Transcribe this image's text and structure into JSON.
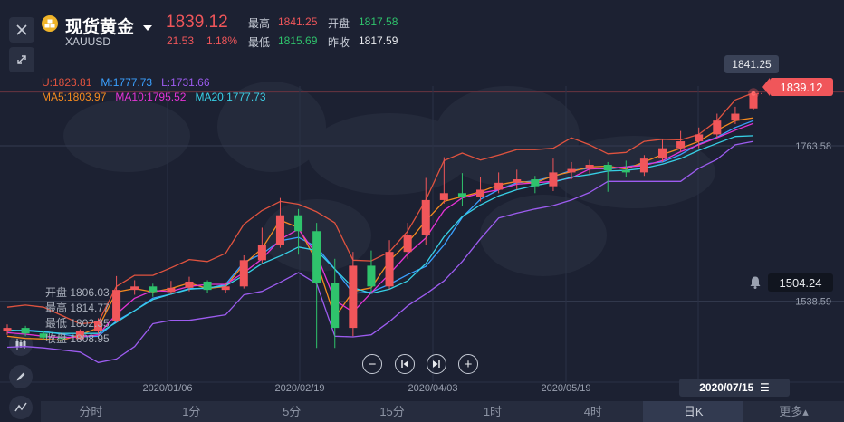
{
  "header": {
    "name": "现货黄金",
    "symbol": "XAUUSD",
    "price": "1839.12",
    "change": "21.53",
    "change_pct": "1.18%",
    "stats": [
      {
        "label": "最高",
        "value": "1841.25",
        "color": "#f0565a"
      },
      {
        "label": "开盘",
        "value": "1817.58",
        "color": "#2fc36c"
      },
      {
        "label": "最低",
        "value": "1815.69",
        "color": "#2fc36c"
      },
      {
        "label": "昨收",
        "value": "1817.59",
        "color": "#e8eaee"
      }
    ]
  },
  "indicators": {
    "boll_u": "U:1823.81",
    "boll_m": "M:1777.73",
    "boll_l": "L:1731.66",
    "ma5": "MA5:1803.97",
    "ma10": "MA10:1795.52",
    "ma20": "MA20:1777.73"
  },
  "crosshair": {
    "open": "开盘 1806.03",
    "high": "最高 1814.77",
    "low": "最低 1802.35",
    "close": "收盘 1808.95"
  },
  "tags": {
    "high_tag": "1841.25",
    "last_price": "1839.12",
    "alert_price": "1504.24",
    "current_date": "2020/07/15"
  },
  "controls": {
    "zoom_out": "−",
    "prev": "⏮",
    "next": "⏭",
    "zoom_in": "+",
    "menu": "☰"
  },
  "timeframes": [
    "分时",
    "1分",
    "5分",
    "15分",
    "1时",
    "4时",
    "日K",
    "更多▴"
  ],
  "active_timeframe": "日K",
  "colors": {
    "background": "#1c2132",
    "up": "#f0565a",
    "down": "#2fc36c",
    "boll_u": "#e0533f",
    "boll_m": "#3aa0ff",
    "boll_l": "#9d5cf0",
    "ma5": "#f58a1f",
    "ma10": "#e633d6",
    "ma20": "#37d0e6"
  },
  "chart_data": {
    "type": "line",
    "x_tick_labels": [
      "2020/01/06",
      "2020/02/19",
      "2020/04/03",
      "2020/05/19",
      "2020/07/15"
    ],
    "y_tick_labels": [
      "1763.58",
      "1538.59"
    ],
    "ylim": [
      1470,
      1850
    ],
    "series": [
      {
        "name": "U",
        "color": "#e0533f",
        "values": [
          1530,
          1533,
          1530,
          1518,
          1506,
          1508,
          1560,
          1576,
          1576,
          1587,
          1599,
          1596,
          1608,
          1650,
          1670,
          1683,
          1679,
          1668,
          1652,
          1598,
          1597,
          1610,
          1640,
          1685,
          1742,
          1753,
          1743,
          1750,
          1758,
          1758,
          1760,
          1775,
          1765,
          1752,
          1754,
          1770,
          1773,
          1772,
          1780,
          1800,
          1830,
          1840
        ]
      },
      {
        "name": "M",
        "color": "#3aa0ff",
        "values": [
          1495,
          1497,
          1495,
          1491,
          1487,
          1488,
          1510,
          1525,
          1543,
          1549,
          1557,
          1557,
          1563,
          1595,
          1607,
          1626,
          1631,
          1617,
          1585,
          1550,
          1552,
          1563,
          1577,
          1589,
          1620,
          1660,
          1686,
          1700,
          1710,
          1713,
          1719,
          1728,
          1731,
          1730,
          1733,
          1737,
          1740,
          1751,
          1766,
          1776,
          1790,
          1800
        ]
      },
      {
        "name": "L",
        "color": "#9d5cf0",
        "values": [
          1472,
          1473,
          1471,
          1468,
          1465,
          1450,
          1455,
          1473,
          1506,
          1511,
          1511,
          1515,
          1519,
          1548,
          1553,
          1566,
          1580,
          1564,
          1488,
          1487,
          1490,
          1509,
          1532,
          1549,
          1568,
          1596,
          1629,
          1659,
          1666,
          1672,
          1677,
          1685,
          1696,
          1712,
          1712,
          1712,
          1712,
          1712,
          1731,
          1744,
          1765,
          1770
        ]
      },
      {
        "name": "MA5",
        "color": "#f58a1f",
        "values": [
          1488,
          1485,
          1484,
          1482,
          1490,
          1500,
          1552,
          1557,
          1552,
          1557,
          1565,
          1557,
          1560,
          1592,
          1615,
          1656,
          1645,
          1596,
          1515,
          1553,
          1558,
          1597,
          1623,
          1655,
          1683,
          1690,
          1697,
          1707,
          1712,
          1710,
          1720,
          1726,
          1733,
          1734,
          1730,
          1740,
          1751,
          1760,
          1770,
          1786,
          1800,
          1804
        ]
      },
      {
        "name": "MA10",
        "color": "#e633d6",
        "values": [
          1493,
          1491,
          1488,
          1486,
          1487,
          1490,
          1520,
          1543,
          1554,
          1553,
          1560,
          1563,
          1563,
          1580,
          1600,
          1628,
          1643,
          1606,
          1540,
          1523,
          1551,
          1578,
          1607,
          1630,
          1670,
          1688,
          1695,
          1700,
          1708,
          1710,
          1712,
          1717,
          1730,
          1731,
          1733,
          1735,
          1742,
          1755,
          1765,
          1775,
          1786,
          1796
        ]
      },
      {
        "name": "MA20",
        "color": "#37d0e6",
        "values": [
          1497,
          1496,
          1494,
          1492,
          1492,
          1492,
          1508,
          1525,
          1541,
          1549,
          1556,
          1558,
          1561,
          1576,
          1593,
          1604,
          1617,
          1612,
          1585,
          1558,
          1550,
          1556,
          1568,
          1593,
          1632,
          1661,
          1678,
          1691,
          1700,
          1706,
          1711,
          1718,
          1722,
          1727,
          1728,
          1731,
          1737,
          1745,
          1757,
          1767,
          1777,
          1778
        ]
      }
    ],
    "candles": [
      {
        "o": 1495,
        "c": 1500,
        "h": 1505,
        "l": 1490
      },
      {
        "o": 1500,
        "c": 1492,
        "h": 1503,
        "l": 1488
      },
      {
        "o": 1492,
        "c": 1486,
        "h": 1495,
        "l": 1482
      },
      {
        "o": 1486,
        "c": 1484,
        "h": 1490,
        "l": 1480
      },
      {
        "o": 1484,
        "c": 1495,
        "h": 1498,
        "l": 1482
      },
      {
        "o": 1495,
        "c": 1510,
        "h": 1514,
        "l": 1492
      },
      {
        "o": 1510,
        "c": 1555,
        "h": 1575,
        "l": 1508
      },
      {
        "o": 1555,
        "c": 1560,
        "h": 1569,
        "l": 1548
      },
      {
        "o": 1560,
        "c": 1552,
        "h": 1564,
        "l": 1545
      },
      {
        "o": 1552,
        "c": 1558,
        "h": 1568,
        "l": 1549
      },
      {
        "o": 1558,
        "c": 1567,
        "h": 1574,
        "l": 1553
      },
      {
        "o": 1567,
        "c": 1555,
        "h": 1569,
        "l": 1551
      },
      {
        "o": 1555,
        "c": 1560,
        "h": 1566,
        "l": 1550
      },
      {
        "o": 1560,
        "c": 1598,
        "h": 1605,
        "l": 1557
      },
      {
        "o": 1598,
        "c": 1620,
        "h": 1645,
        "l": 1594
      },
      {
        "o": 1620,
        "c": 1663,
        "h": 1688,
        "l": 1616
      },
      {
        "o": 1663,
        "c": 1640,
        "h": 1672,
        "l": 1606
      },
      {
        "o": 1640,
        "c": 1565,
        "h": 1652,
        "l": 1471
      },
      {
        "o": 1565,
        "c": 1500,
        "h": 1600,
        "l": 1471
      },
      {
        "o": 1500,
        "c": 1590,
        "h": 1610,
        "l": 1488
      },
      {
        "o": 1590,
        "c": 1560,
        "h": 1612,
        "l": 1552
      },
      {
        "o": 1560,
        "c": 1610,
        "h": 1627,
        "l": 1556
      },
      {
        "o": 1610,
        "c": 1635,
        "h": 1652,
        "l": 1600
      },
      {
        "o": 1635,
        "c": 1685,
        "h": 1717,
        "l": 1620
      },
      {
        "o": 1685,
        "c": 1695,
        "h": 1747,
        "l": 1680
      },
      {
        "o": 1695,
        "c": 1690,
        "h": 1724,
        "l": 1677
      },
      {
        "o": 1690,
        "c": 1700,
        "h": 1718,
        "l": 1683
      },
      {
        "o": 1700,
        "c": 1710,
        "h": 1725,
        "l": 1695
      },
      {
        "o": 1710,
        "c": 1715,
        "h": 1729,
        "l": 1700
      },
      {
        "o": 1715,
        "c": 1705,
        "h": 1720,
        "l": 1695
      },
      {
        "o": 1705,
        "c": 1725,
        "h": 1745,
        "l": 1698
      },
      {
        "o": 1725,
        "c": 1730,
        "h": 1740,
        "l": 1715
      },
      {
        "o": 1730,
        "c": 1736,
        "h": 1743,
        "l": 1722
      },
      {
        "o": 1736,
        "c": 1728,
        "h": 1740,
        "l": 1697
      },
      {
        "o": 1728,
        "c": 1725,
        "h": 1742,
        "l": 1718
      },
      {
        "o": 1725,
        "c": 1745,
        "h": 1750,
        "l": 1720
      },
      {
        "o": 1745,
        "c": 1760,
        "h": 1772,
        "l": 1740
      },
      {
        "o": 1760,
        "c": 1770,
        "h": 1785,
        "l": 1755
      },
      {
        "o": 1770,
        "c": 1780,
        "h": 1790,
        "l": 1760
      },
      {
        "o": 1780,
        "c": 1800,
        "h": 1810,
        "l": 1775
      },
      {
        "o": 1800,
        "c": 1810,
        "h": 1820,
        "l": 1795
      },
      {
        "o": 1817.58,
        "c": 1839.12,
        "h": 1841.25,
        "l": 1815.69
      }
    ]
  }
}
